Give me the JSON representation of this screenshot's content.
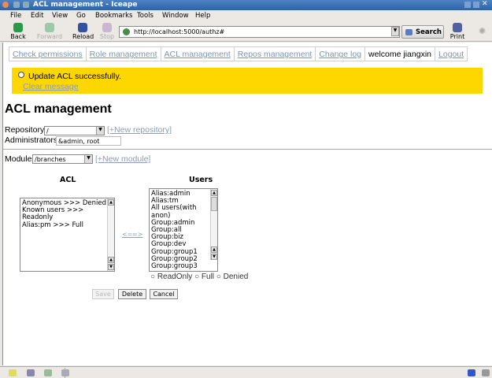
{
  "window": {
    "title": "ACL management - Iceape"
  },
  "menu": [
    "File",
    "Edit",
    "View",
    "Go",
    "Bookmarks",
    "Tools",
    "Window",
    "Help"
  ],
  "toolbar": {
    "back": "Back",
    "forward": "Forward",
    "reload": "Reload",
    "stop": "Stop",
    "url": "http://localhost:5000/authz#",
    "search": "Search",
    "print": "Print"
  },
  "nav": {
    "check": "Check permissions",
    "role": "Role management",
    "acl": "ACL management",
    "repos": "Repos management",
    "changelog": "Change log",
    "welcome": "welcome jiangxin",
    "logout": "Logout"
  },
  "message": {
    "text": "Update ACL successfully.",
    "clear": "Clear message"
  },
  "page": {
    "title": "ACL management",
    "repo_label": "Repository:",
    "repo_value": "/",
    "new_repo": "[+New repository]",
    "admin_label": "Administrators:",
    "admin_value": "&admin, root",
    "module_label": "Module:",
    "module_value": "/branches",
    "new_module": "[+New module]"
  },
  "acl": {
    "title": "ACL",
    "items": [
      "Anonymous >>> Denied",
      "Known users >>> Readonly",
      "Alias:pm >>> Full"
    ]
  },
  "users": {
    "title": "Users",
    "items": [
      "Alias:admin",
      "Alias:tm",
      "All users(with anon)",
      "Group:admin",
      "Group:all",
      "Group:biz",
      "Group:dev",
      "Group:group1",
      "Group:group2",
      "Group:group3"
    ]
  },
  "move": {
    "left": "<=",
    "right": "=>"
  },
  "perm": {
    "readonly": "ReadOnly",
    "full": "Full",
    "denied": "Denied"
  },
  "buttons": {
    "save": "Save",
    "delete": "Delete",
    "cancel": "Cancel"
  }
}
